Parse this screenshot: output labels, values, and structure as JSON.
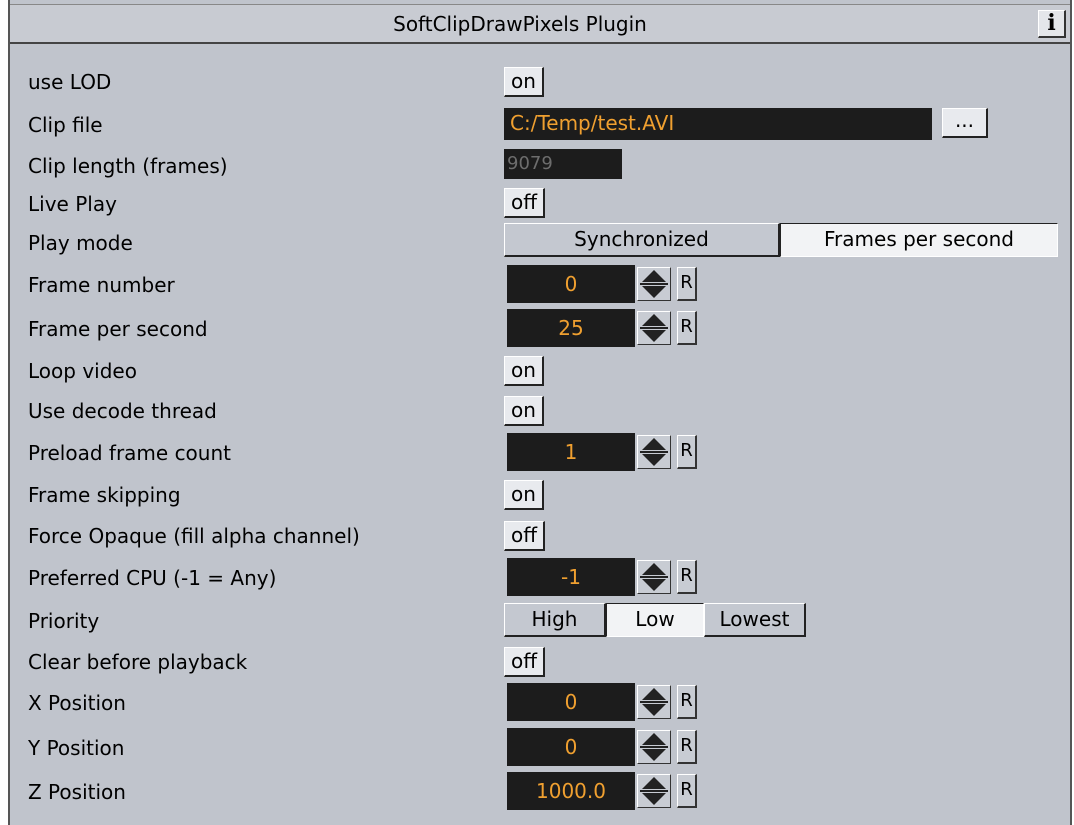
{
  "title": "SoftClipDrawPixels Plugin",
  "info_label": "i",
  "browse_label": "...",
  "reset_label": "R",
  "rows": {
    "use_lod": {
      "label": "use LOD",
      "value": "on"
    },
    "clip_file": {
      "label": "Clip file",
      "value": "C:/Temp/test.AVI"
    },
    "clip_length": {
      "label": "Clip length (frames)",
      "value": "9079"
    },
    "live_play": {
      "label": "Live Play",
      "value": "off"
    },
    "play_mode": {
      "label": "Play mode",
      "options": [
        "Synchronized",
        "Frames per second"
      ],
      "selected": "Frames per second"
    },
    "frame_number": {
      "label": "Frame number",
      "value": "0"
    },
    "frame_per_second": {
      "label": "Frame per second",
      "value": "25"
    },
    "loop_video": {
      "label": "Loop video",
      "value": "on"
    },
    "use_decode_thread": {
      "label": "Use decode thread",
      "value": "on"
    },
    "preload_frame_count": {
      "label": "Preload frame count",
      "value": "1"
    },
    "frame_skipping": {
      "label": "Frame skipping",
      "value": "on"
    },
    "force_opaque": {
      "label": "Force Opaque (fill alpha channel)",
      "value": "off"
    },
    "preferred_cpu": {
      "label": "Preferred CPU (-1 = Any)",
      "value": "-1"
    },
    "priority": {
      "label": "Priority",
      "options": [
        "High",
        "Low",
        "Lowest"
      ],
      "selected": "Low"
    },
    "clear_before_playback": {
      "label": "Clear before playback",
      "value": "off"
    },
    "x_position": {
      "label": "X Position",
      "value": "0"
    },
    "y_position": {
      "label": "Y Position",
      "value": "0"
    },
    "z_position": {
      "label": "Z Position",
      "value": "1000.0"
    }
  },
  "colors": {
    "panel_bg": "#c0c4cc",
    "field_bg": "#1c1c1c",
    "field_text": "#f0a030",
    "disabled_text": "#6d6d6d"
  }
}
